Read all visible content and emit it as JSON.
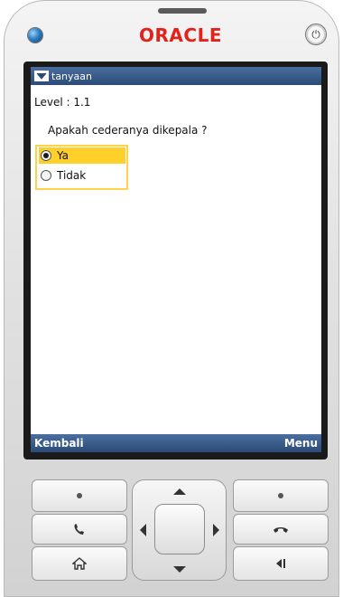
{
  "device": {
    "brand": "ORACLE"
  },
  "screen": {
    "title": "tanyaan",
    "level_label": "Level : ",
    "level_value": "1.1",
    "question": "Apakah cederanya dikepala ?",
    "options": [
      {
        "label": "Ya",
        "selected": true
      },
      {
        "label": "Tidak",
        "selected": false
      }
    ],
    "softkeys": {
      "left": "Kembali",
      "right": "Menu"
    }
  },
  "keypad": {
    "keys": [
      {
        "name": "left-soft-key",
        "icon": "dot-icon"
      },
      {
        "name": "right-soft-key",
        "icon": "dot-icon"
      },
      {
        "name": "call-key",
        "icon": "phone-icon"
      },
      {
        "name": "end-call-key",
        "icon": "hang-up-icon"
      },
      {
        "name": "home-key",
        "icon": "home-icon"
      },
      {
        "name": "back-key",
        "icon": "back-icon"
      }
    ]
  },
  "colors": {
    "titlebar": "#2b4a77",
    "selection": "#ffd02a",
    "brand_red": "#e2231a",
    "focus_border": "#ffd24d"
  }
}
